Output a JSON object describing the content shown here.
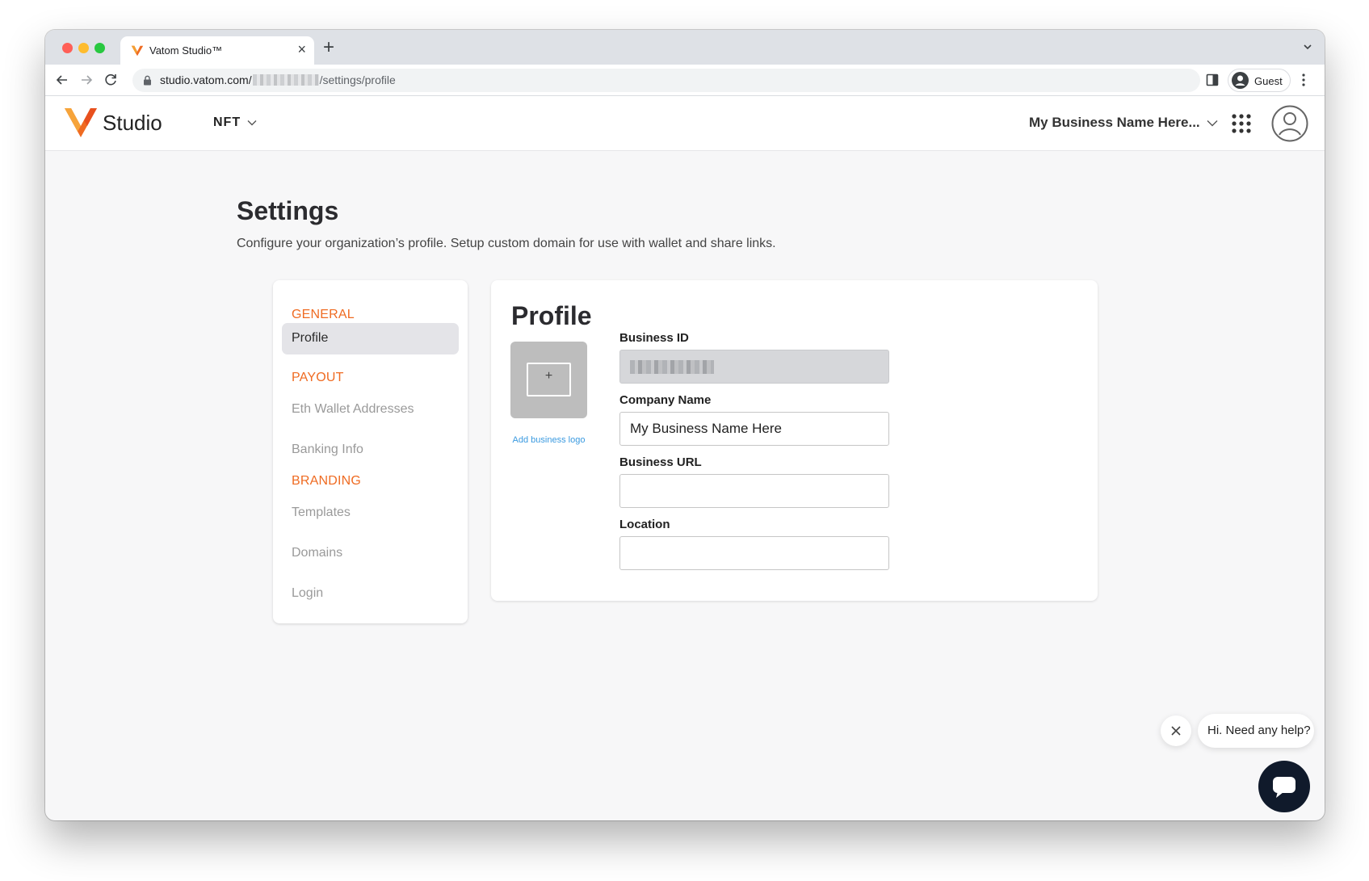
{
  "browser": {
    "tab_title": "Vatom Studio™",
    "tab_close": "×",
    "new_tab": "+",
    "url_host": "studio.vatom.com/",
    "url_path": "/settings/profile",
    "profile_label": "Guest"
  },
  "header": {
    "brand": "Studio",
    "nft_menu": "NFT",
    "business_menu": "My Business Name Here...",
    "brand_color": "#ef6b22"
  },
  "page": {
    "title": "Settings",
    "subtitle": "Configure your organization’s profile. Setup custom domain for use with wallet and share links."
  },
  "sidenav": {
    "general": "GENERAL",
    "profile": "Profile",
    "payout": "PAYOUT",
    "eth_wallet": "Eth Wallet Addresses",
    "banking": "Banking Info",
    "branding": "BRANDING",
    "templates": "Templates",
    "domains": "Domains",
    "login": "Login"
  },
  "profile": {
    "title": "Profile",
    "logo_plus": "+",
    "add_logo": "Add business logo",
    "business_id_label": "Business ID",
    "company_name_label": "Company Name",
    "company_name_value": "My Business Name Here",
    "business_url_label": "Business URL",
    "business_url_value": "",
    "location_label": "Location",
    "location_value": ""
  },
  "chat": {
    "message": "Hi. Need any help?"
  }
}
